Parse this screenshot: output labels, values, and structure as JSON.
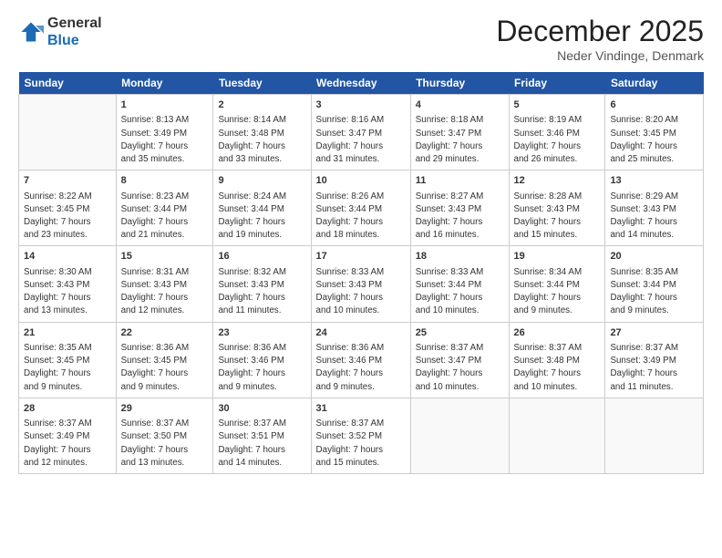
{
  "logo": {
    "general": "General",
    "blue": "Blue"
  },
  "header": {
    "month": "December 2025",
    "location": "Neder Vindinge, Denmark"
  },
  "days": [
    "Sunday",
    "Monday",
    "Tuesday",
    "Wednesday",
    "Thursday",
    "Friday",
    "Saturday"
  ],
  "weeks": [
    [
      {
        "day": "",
        "content": ""
      },
      {
        "day": "1",
        "content": "Sunrise: 8:13 AM\nSunset: 3:49 PM\nDaylight: 7 hours\nand 35 minutes."
      },
      {
        "day": "2",
        "content": "Sunrise: 8:14 AM\nSunset: 3:48 PM\nDaylight: 7 hours\nand 33 minutes."
      },
      {
        "day": "3",
        "content": "Sunrise: 8:16 AM\nSunset: 3:47 PM\nDaylight: 7 hours\nand 31 minutes."
      },
      {
        "day": "4",
        "content": "Sunrise: 8:18 AM\nSunset: 3:47 PM\nDaylight: 7 hours\nand 29 minutes."
      },
      {
        "day": "5",
        "content": "Sunrise: 8:19 AM\nSunset: 3:46 PM\nDaylight: 7 hours\nand 26 minutes."
      },
      {
        "day": "6",
        "content": "Sunrise: 8:20 AM\nSunset: 3:45 PM\nDaylight: 7 hours\nand 25 minutes."
      }
    ],
    [
      {
        "day": "7",
        "content": "Sunrise: 8:22 AM\nSunset: 3:45 PM\nDaylight: 7 hours\nand 23 minutes."
      },
      {
        "day": "8",
        "content": "Sunrise: 8:23 AM\nSunset: 3:44 PM\nDaylight: 7 hours\nand 21 minutes."
      },
      {
        "day": "9",
        "content": "Sunrise: 8:24 AM\nSunset: 3:44 PM\nDaylight: 7 hours\nand 19 minutes."
      },
      {
        "day": "10",
        "content": "Sunrise: 8:26 AM\nSunset: 3:44 PM\nDaylight: 7 hours\nand 18 minutes."
      },
      {
        "day": "11",
        "content": "Sunrise: 8:27 AM\nSunset: 3:43 PM\nDaylight: 7 hours\nand 16 minutes."
      },
      {
        "day": "12",
        "content": "Sunrise: 8:28 AM\nSunset: 3:43 PM\nDaylight: 7 hours\nand 15 minutes."
      },
      {
        "day": "13",
        "content": "Sunrise: 8:29 AM\nSunset: 3:43 PM\nDaylight: 7 hours\nand 14 minutes."
      }
    ],
    [
      {
        "day": "14",
        "content": "Sunrise: 8:30 AM\nSunset: 3:43 PM\nDaylight: 7 hours\nand 13 minutes."
      },
      {
        "day": "15",
        "content": "Sunrise: 8:31 AM\nSunset: 3:43 PM\nDaylight: 7 hours\nand 12 minutes."
      },
      {
        "day": "16",
        "content": "Sunrise: 8:32 AM\nSunset: 3:43 PM\nDaylight: 7 hours\nand 11 minutes."
      },
      {
        "day": "17",
        "content": "Sunrise: 8:33 AM\nSunset: 3:43 PM\nDaylight: 7 hours\nand 10 minutes."
      },
      {
        "day": "18",
        "content": "Sunrise: 8:33 AM\nSunset: 3:44 PM\nDaylight: 7 hours\nand 10 minutes."
      },
      {
        "day": "19",
        "content": "Sunrise: 8:34 AM\nSunset: 3:44 PM\nDaylight: 7 hours\nand 9 minutes."
      },
      {
        "day": "20",
        "content": "Sunrise: 8:35 AM\nSunset: 3:44 PM\nDaylight: 7 hours\nand 9 minutes."
      }
    ],
    [
      {
        "day": "21",
        "content": "Sunrise: 8:35 AM\nSunset: 3:45 PM\nDaylight: 7 hours\nand 9 minutes."
      },
      {
        "day": "22",
        "content": "Sunrise: 8:36 AM\nSunset: 3:45 PM\nDaylight: 7 hours\nand 9 minutes."
      },
      {
        "day": "23",
        "content": "Sunrise: 8:36 AM\nSunset: 3:46 PM\nDaylight: 7 hours\nand 9 minutes."
      },
      {
        "day": "24",
        "content": "Sunrise: 8:36 AM\nSunset: 3:46 PM\nDaylight: 7 hours\nand 9 minutes."
      },
      {
        "day": "25",
        "content": "Sunrise: 8:37 AM\nSunset: 3:47 PM\nDaylight: 7 hours\nand 10 minutes."
      },
      {
        "day": "26",
        "content": "Sunrise: 8:37 AM\nSunset: 3:48 PM\nDaylight: 7 hours\nand 10 minutes."
      },
      {
        "day": "27",
        "content": "Sunrise: 8:37 AM\nSunset: 3:49 PM\nDaylight: 7 hours\nand 11 minutes."
      }
    ],
    [
      {
        "day": "28",
        "content": "Sunrise: 8:37 AM\nSunset: 3:49 PM\nDaylight: 7 hours\nand 12 minutes."
      },
      {
        "day": "29",
        "content": "Sunrise: 8:37 AM\nSunset: 3:50 PM\nDaylight: 7 hours\nand 13 minutes."
      },
      {
        "day": "30",
        "content": "Sunrise: 8:37 AM\nSunset: 3:51 PM\nDaylight: 7 hours\nand 14 minutes."
      },
      {
        "day": "31",
        "content": "Sunrise: 8:37 AM\nSunset: 3:52 PM\nDaylight: 7 hours\nand 15 minutes."
      },
      {
        "day": "",
        "content": ""
      },
      {
        "day": "",
        "content": ""
      },
      {
        "day": "",
        "content": ""
      }
    ]
  ]
}
